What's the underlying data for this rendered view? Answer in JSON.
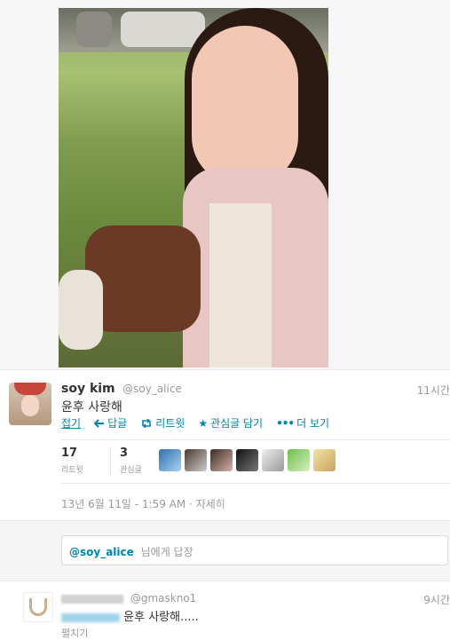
{
  "tweet": {
    "name": "soy kim",
    "handle": "@soy_alice",
    "time": "11시간",
    "text": "윤후 사랑해",
    "actions": {
      "collapse": "접기",
      "reply": "답글",
      "retweet": "리트윗",
      "favorite": "관심글 담기",
      "more": "더 보기"
    },
    "stats": {
      "retweets": {
        "count": "17",
        "label": "리트윗"
      },
      "favorites": {
        "count": "3",
        "label": "관심글"
      }
    },
    "date": "13년 6월 11일 - 1:59 AM",
    "detail_link": "자세히"
  },
  "reply_box": {
    "mention": "@soy_alice",
    "suffix": "님에게 답장"
  },
  "reply_tweet": {
    "handle": "@gmaskno1",
    "time": "9시간",
    "text": "윤후 사랑해.....",
    "expand": "펼치기"
  },
  "icons": {
    "reply": "reply-arrow-icon",
    "retweet": "retweet-icon",
    "favorite": "star-icon",
    "more": "dots-icon"
  },
  "colors": {
    "link": "#0084b4",
    "muted": "#999999"
  }
}
